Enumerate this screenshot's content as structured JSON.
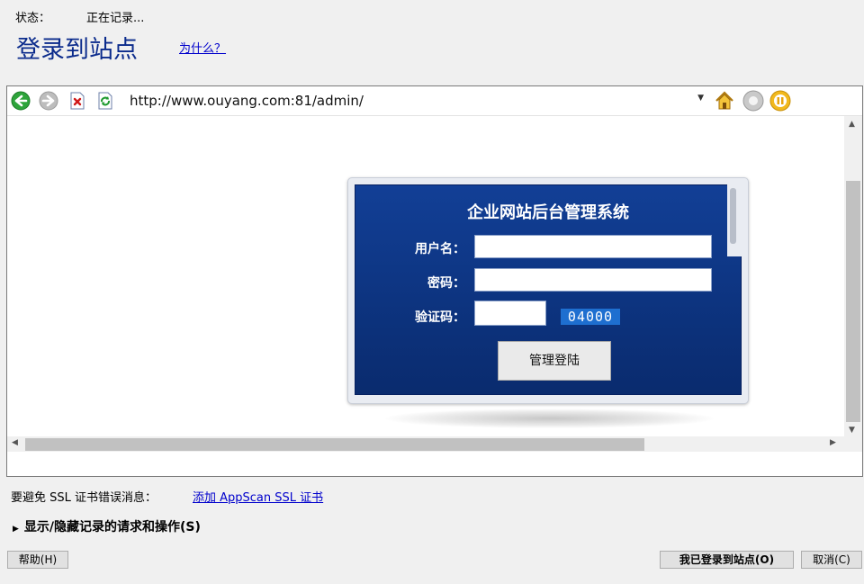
{
  "status": {
    "label": "状态：",
    "value": "正在记录..."
  },
  "header": {
    "title": "登录到站点",
    "why_link": "为什么？"
  },
  "browser": {
    "url": "http://www.ouyang.com:81/admin/",
    "toolbar_icons": [
      "back-icon",
      "forward-icon",
      "stop-icon",
      "refresh-icon",
      "home-icon",
      "record-icon",
      "pause-icon"
    ]
  },
  "login_form": {
    "title": "企业网站后台管理系统",
    "username_label": "用户名：",
    "password_label": "密码：",
    "captcha_label": "验证码：",
    "captcha_text": "04000",
    "submit_label": "管理登陆"
  },
  "ssl": {
    "label": "要避免 SSL 证书错误消息：",
    "link": "添加 AppScan SSL 证书"
  },
  "toggle_label": "显示/隐藏记录的请求和操作(S)",
  "buttons": {
    "help": "帮助(H)",
    "logged_in": "我已登录到站点(O)",
    "cancel": "取消(C)"
  },
  "colors": {
    "title": "#0b2b8c",
    "link": "#0000cc",
    "panel": "#0d3480"
  }
}
